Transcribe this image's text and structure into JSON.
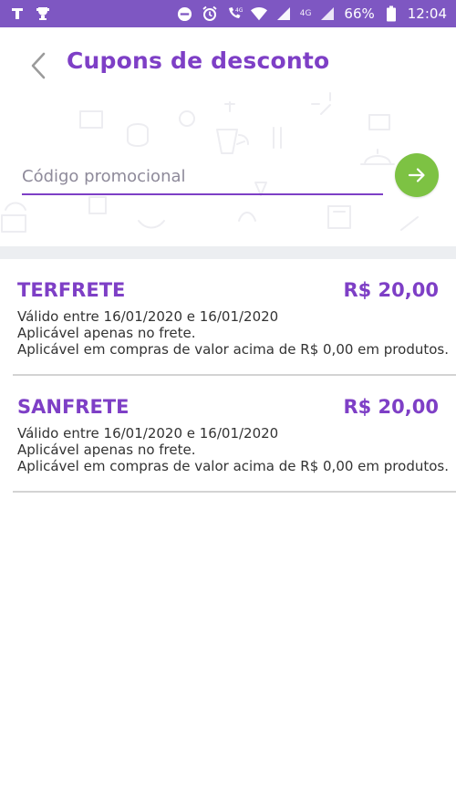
{
  "status_bar": {
    "battery": "66%",
    "time": "12:04",
    "network_label": "4G"
  },
  "header": {
    "title": "Cupons de desconto"
  },
  "promo": {
    "placeholder": "Código promocional"
  },
  "coupons": [
    {
      "code": "TERFRETE",
      "value": "R$ 20,00",
      "validity": "Válido entre 16/01/2020 e 16/01/2020",
      "scope": "Aplicável apenas no frete.",
      "condition": "Aplicável em compras de valor acima de R$ 0,00 em produtos."
    },
    {
      "code": "SANFRETE",
      "value": "R$ 20,00",
      "validity": "Válido entre 16/01/2020 e 16/01/2020",
      "scope": "Aplicável apenas no frete.",
      "condition": "Aplicável em compras de valor acima de R$ 0,00 em produtos."
    }
  ],
  "colors": {
    "accent": "#7e3fc6",
    "status_bar": "#7e57c2",
    "go_button": "#7dc243"
  }
}
